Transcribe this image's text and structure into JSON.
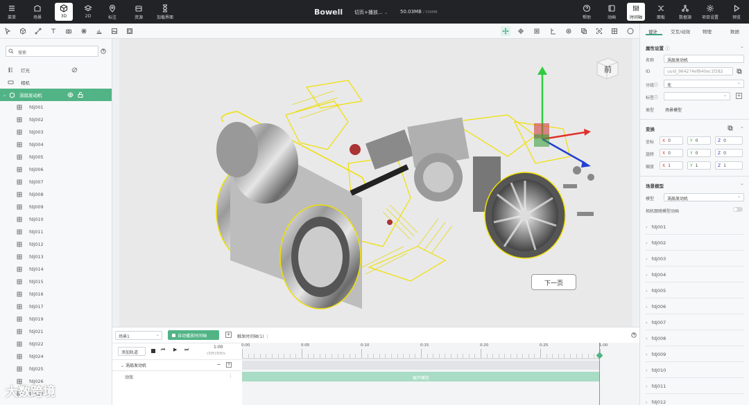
{
  "topbar": {
    "menu": "菜单",
    "scene": "场景",
    "mode3d": "3D",
    "mode2d": "2D",
    "annotate": "标注",
    "assets": "资源",
    "loading": "加载界面",
    "logo": "Bowell",
    "title": "切页+播放...",
    "memory_used": "50.03MB",
    "memory_total": "/ 500MB",
    "help": "帮助",
    "animation": "动画",
    "timeline": "时间轴",
    "panel": "面板",
    "datasource": "数据源",
    "project_settings": "项目设置",
    "preview": "预览"
  },
  "left": {
    "search_placeholder": "搜索",
    "items": [
      {
        "label": "灯光",
        "icon": "light-icon"
      },
      {
        "label": "相机",
        "icon": "camera-icon"
      },
      {
        "label": "涡扇发动机",
        "icon": "model-icon"
      }
    ],
    "children": [
      "fdj001",
      "fdj002",
      "fdj003",
      "fdj004",
      "fdj005",
      "fdj006",
      "fdj007",
      "fdj008",
      "fdj009",
      "fdj010",
      "fdj011",
      "fdj012",
      "fdj013",
      "fdj014",
      "fdj015",
      "fdj016",
      "fdj017",
      "fdj019",
      "fdj021",
      "fdj022",
      "fdj024",
      "fdj025",
      "fdj026",
      "fdj027"
    ]
  },
  "viewport": {
    "cube_label": "前",
    "next_button": "下一页"
  },
  "right": {
    "tabs": [
      "设计",
      "交互/动效",
      "物理",
      "数据"
    ],
    "props_title": "属性设置",
    "name_label": "名称",
    "name_value": "涡扇发动机",
    "id_label": "ID",
    "id_value": "uuid_964274ef840ec1f282",
    "group_label": "分组",
    "group_value": "无",
    "tag_label": "标签",
    "type_label": "类型",
    "type_value": "场景模型",
    "transform_title": "变换",
    "pos_label": "坐标",
    "rot_label": "旋转",
    "scale_label": "缩放",
    "pos": [
      "0",
      "0",
      "0"
    ],
    "rot": [
      "0",
      "0",
      "0"
    ],
    "scale": [
      "1",
      "1",
      "1"
    ],
    "scene_model_title": "场景模型",
    "model_label": "模型",
    "model_value": "涡扇发动机",
    "follow_label": "相机跟随模型动画",
    "children": [
      "fdj001",
      "fdj002",
      "fdj003",
      "fdj004",
      "fdj005",
      "fdj006",
      "fdj007",
      "fdj008",
      "fdj009",
      "fdj010",
      "fdj011",
      "fdj012"
    ]
  },
  "timeline": {
    "scene_select": "场景1",
    "autoplay": "自动播放时间轴",
    "trigger": "触发时间轴(1)",
    "add_track": "添加轨道",
    "time": "1:00",
    "fps": "(30f)30f/s",
    "ticks": [
      "0:00",
      "0:05",
      "0:10",
      "0:15",
      "0:20",
      "0:25",
      "1:00"
    ],
    "track_name": "涡扇发动机",
    "subtrack": "动效",
    "clip_label": "展开模型"
  },
  "watermark": "大数跨境"
}
